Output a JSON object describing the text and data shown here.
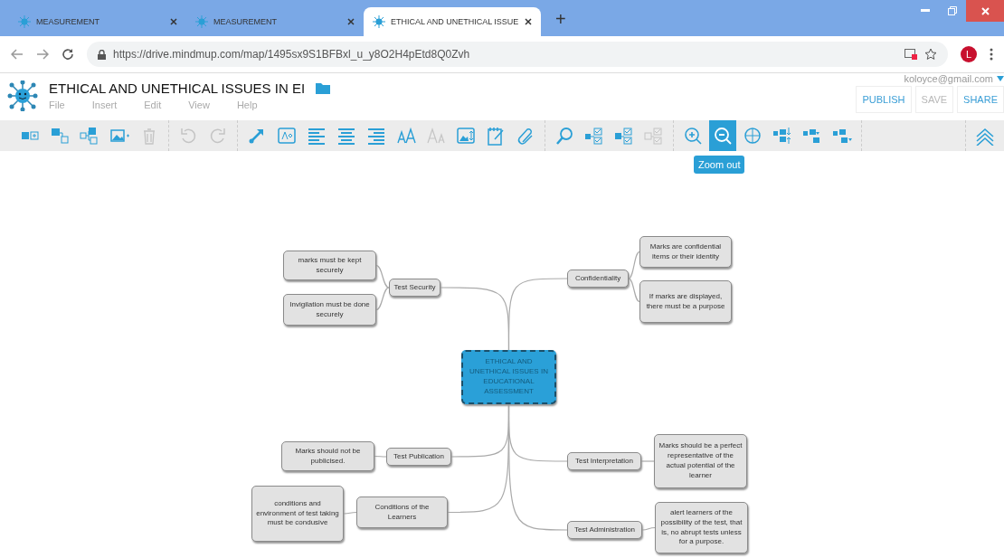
{
  "browser": {
    "tabs": [
      {
        "title": "MEASUREMENT",
        "selected": false
      },
      {
        "title": "MEASUREMENT",
        "selected": false
      },
      {
        "title": "ETHICAL AND UNETHICAL ISSUE",
        "selected": true
      }
    ],
    "new_tab": "+",
    "address": "https://drive.mindmup.com/map/1495sx9S1BFBxl_u_y8O2H4pEtd8Q0Zvh",
    "avatar": "L"
  },
  "app": {
    "title": "ETHICAL AND UNETHICAL ISSUES IN EI",
    "menu": [
      "File",
      "Insert",
      "Edit",
      "View",
      "Help"
    ],
    "account": "koloyce@gmail.com",
    "buttons": [
      {
        "label": "PUBLISH",
        "disabled": false
      },
      {
        "label": "SAVE",
        "disabled": true
      },
      {
        "label": "SHARE",
        "disabled": false
      }
    ]
  },
  "toolbar": {
    "groups": [
      [
        {
          "disabled": false,
          "selected": false
        },
        {
          "disabled": false,
          "selected": false
        },
        {
          "disabled": false,
          "selected": false
        },
        {
          "disabled": false,
          "selected": false
        },
        {
          "disabled": true,
          "selected": false
        }
      ],
      [
        {
          "disabled": true,
          "selected": false
        },
        {
          "disabled": true,
          "selected": false
        }
      ],
      [
        {
          "disabled": false,
          "selected": false
        },
        {
          "disabled": false,
          "selected": false
        },
        {
          "disabled": false,
          "selected": false
        },
        {
          "disabled": false,
          "selected": false
        },
        {
          "disabled": false,
          "selected": false
        },
        {
          "disabled": false,
          "selected": false
        },
        {
          "disabled": true,
          "selected": false
        },
        {
          "disabled": false,
          "selected": false
        },
        {
          "disabled": false,
          "selected": false
        },
        {
          "disabled": false,
          "selected": false
        }
      ],
      [
        {
          "disabled": false,
          "selected": false
        },
        {
          "disabled": false,
          "selected": false
        },
        {
          "disabled": false,
          "selected": false
        },
        {
          "disabled": true,
          "selected": false
        }
      ],
      [
        {
          "disabled": false,
          "selected": false
        },
        {
          "disabled": false,
          "selected": true
        },
        {
          "disabled": false,
          "selected": false
        },
        {
          "disabled": false,
          "selected": false
        },
        {
          "disabled": false,
          "selected": false
        },
        {
          "disabled": false,
          "selected": false
        }
      ],
      [
        {
          "disabled": false,
          "selected": false
        }
      ]
    ],
    "tooltip": "Zoom out"
  },
  "mind_map": {
    "root": {
      "text": "ETHICAL AND UNETHICAL ISSUES IN EDUCATIONAL ASSESSMENT",
      "selected": true,
      "children": [
        {
          "text": "Test Security",
          "children": [
            {
              "text": "marks must be kept securely"
            },
            {
              "text": "Invigilation must be done securely"
            }
          ]
        },
        {
          "text": "Confidentiality",
          "children": [
            {
              "text": "Marks are confidential items or their identity"
            },
            {
              "text": "If marks are displayed, there must be a purpose"
            }
          ]
        },
        {
          "text": "Test Publication",
          "children": [
            {
              "text": "Marks should not be publicised."
            }
          ]
        },
        {
          "text": "Test Interpretation",
          "children": [
            {
              "text": "Marks should be a perfect representative of the actual potential of the learner"
            }
          ]
        },
        {
          "text": "Conditions of the Learners",
          "children": [
            {
              "text": "conditions and environment of test taking must be condusive"
            }
          ]
        },
        {
          "text": "Test Administration",
          "children": [
            {
              "text": "alert learners of the possibility of the test, that is, no abrupt tests unless for a purpose."
            }
          ]
        }
      ]
    }
  }
}
